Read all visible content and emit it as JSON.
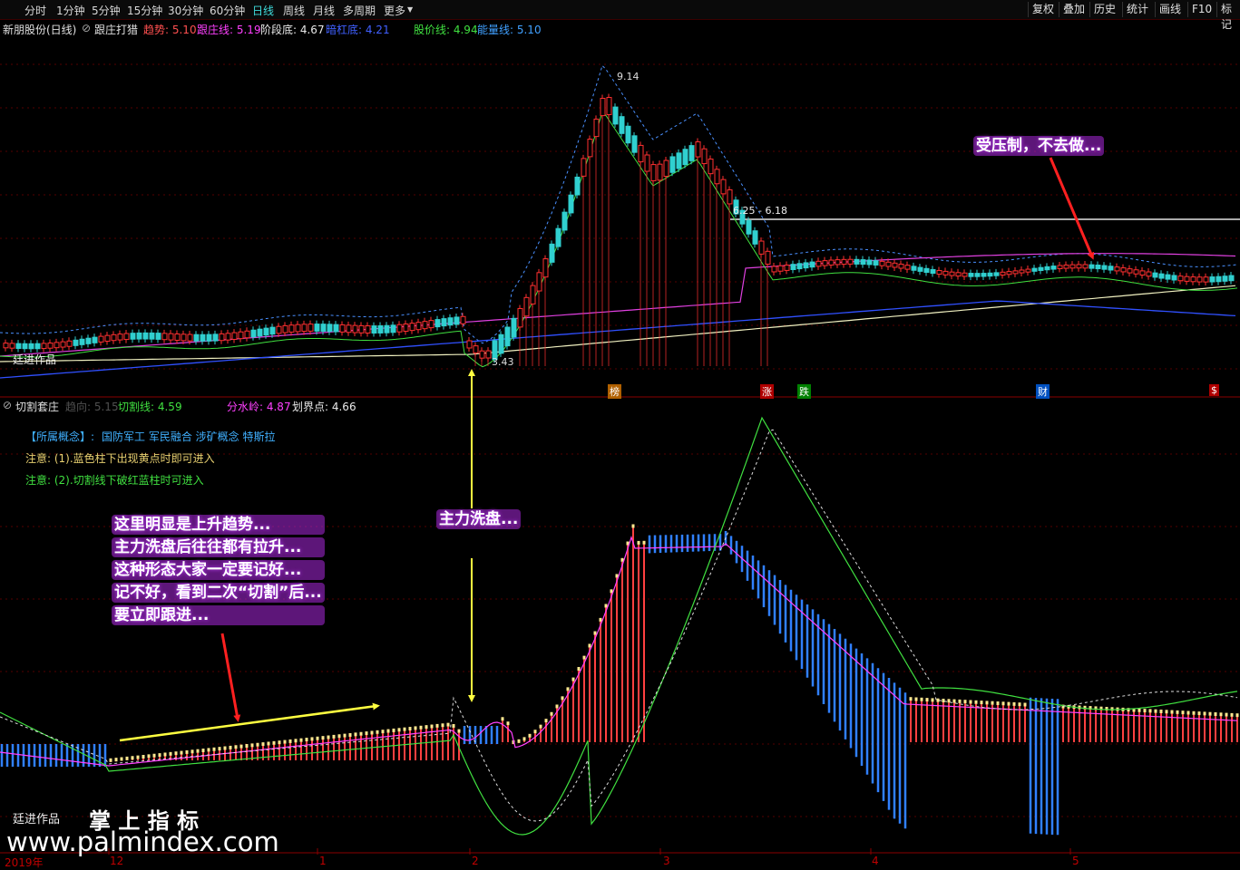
{
  "periods": [
    {
      "label": "分时",
      "active": false
    },
    {
      "label": "1分钟",
      "active": false
    },
    {
      "label": "5分钟",
      "active": false
    },
    {
      "label": "15分钟",
      "active": false
    },
    {
      "label": "30分钟",
      "active": false
    },
    {
      "label": "60分钟",
      "active": false
    },
    {
      "label": "日线",
      "active": true
    },
    {
      "label": "周线",
      "active": false
    },
    {
      "label": "月线",
      "active": false
    },
    {
      "label": "多周期",
      "active": false
    },
    {
      "label": "更多",
      "active": false
    }
  ],
  "right_buttons": [
    "复权",
    "叠加",
    "历史",
    "统计",
    "画线",
    "F10",
    "标记"
  ],
  "main": {
    "stock": "新朋股份(日线)",
    "indicator": "跟庄打猎",
    "items": [
      {
        "text": "趋势: 5.10",
        "color": "#ff5050"
      },
      {
        "text": "跟庄线: 5.19",
        "color": "#ff40ff"
      },
      {
        "text": "阶段底: 4.67",
        "color": "#e8e8e8"
      },
      {
        "text": "暗杠底: 4.21",
        "color": "#4060ff"
      },
      {
        "text": "股价线: 4.94",
        "color": "#40e040"
      },
      {
        "text": "能量线: 5.10",
        "color": "#40a0ff"
      }
    ],
    "high_label": "9.14",
    "low_label": "3.43",
    "level_label": "6.25 - 6.18",
    "author": "廷进作品",
    "markers": [
      {
        "text": "榜",
        "bg": "#b06000"
      },
      {
        "text": "涨",
        "bg": "#b00000"
      },
      {
        "text": "跌",
        "bg": "#008000"
      },
      {
        "text": "财",
        "bg": "#0050c0"
      },
      {
        "text": "$",
        "bg": "#b00000"
      }
    ]
  },
  "sub": {
    "indicator": "切割套庄",
    "items": [
      {
        "text": "趋向: 5.15",
        "color": "#505050"
      },
      {
        "text": "切割线: 4.59",
        "color": "#40e040"
      },
      {
        "text": "分水岭: 4.87",
        "color": "#ff40ff"
      },
      {
        "text": "划界点: 4.66",
        "color": "#e8e8e8"
      }
    ],
    "concept_label": "【所属概念】:",
    "concept_value": "国防军工 军民融合 涉矿概念 特斯拉",
    "note1": "注意: (1).蓝色柱下出现黄点时即可进入",
    "note2": "注意: (2).切割线下破红蓝柱时可进入",
    "author": "廷进作品"
  },
  "annotations": {
    "pressure": "受压制，不去做...",
    "wash": "主力洗盘...",
    "lines": [
      "这里明显是上升趋势...",
      "主力洗盘后往往都有拉升...",
      "这种形态大家一定要记好...",
      "记不好，看到二次“切割”后...",
      "要立即跟进..."
    ]
  },
  "watermark": {
    "title": "掌 上 指 标",
    "url": "www.palmindex.com"
  },
  "xaxis": {
    "labels": [
      "2019年",
      "12",
      "1",
      "2",
      "3",
      "4",
      "5"
    ]
  },
  "colors": {
    "up": "#ff3030",
    "down": "#30d0d0",
    "bg": "#000000",
    "grid": "#550000"
  }
}
